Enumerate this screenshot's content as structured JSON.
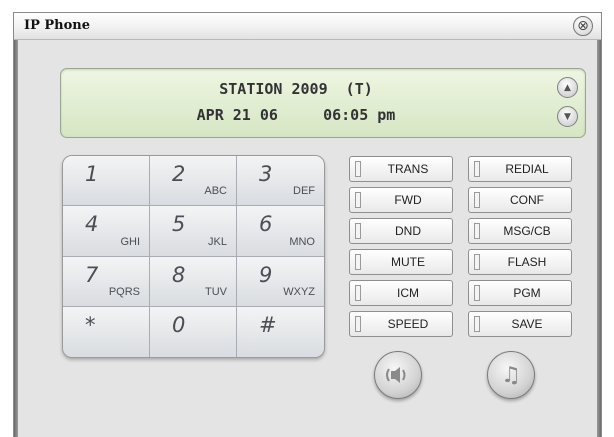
{
  "window": {
    "title": "IP Phone",
    "close_icon": "⊗"
  },
  "display": {
    "line1": "STATION 2009  (T)",
    "line2": "APR 21 06     06:05 pm",
    "up_icon": "▲",
    "down_icon": "▼"
  },
  "keypad": [
    {
      "num": "1",
      "letters": ""
    },
    {
      "num": "2",
      "letters": "ABC"
    },
    {
      "num": "3",
      "letters": "DEF"
    },
    {
      "num": "4",
      "letters": "GHI"
    },
    {
      "num": "5",
      "letters": "JKL"
    },
    {
      "num": "6",
      "letters": "MNO"
    },
    {
      "num": "7",
      "letters": "PQRS"
    },
    {
      "num": "8",
      "letters": "TUV"
    },
    {
      "num": "9",
      "letters": "WXYZ"
    },
    {
      "num": "*",
      "letters": ""
    },
    {
      "num": "0",
      "letters": ""
    },
    {
      "num": "#",
      "letters": ""
    }
  ],
  "function_buttons": {
    "left": [
      "TRANS",
      "FWD",
      "DND",
      "MUTE",
      "ICM",
      "SPEED"
    ],
    "right": [
      "REDIAL",
      "CONF",
      "MSG/CB",
      "FLASH",
      "PGM",
      "SAVE"
    ]
  },
  "bottom_buttons": {
    "speaker_icon": "◖▮◗",
    "music_icon": "♫"
  }
}
